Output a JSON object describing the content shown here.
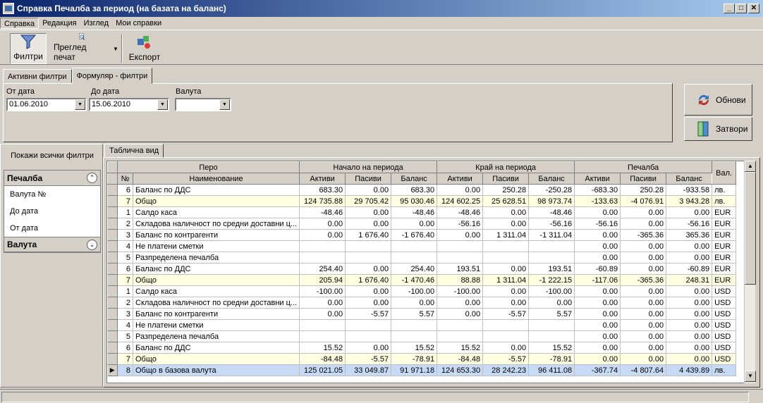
{
  "window": {
    "title": "Справка Печалба за период (на базата на баланс)"
  },
  "menu": [
    "Справка",
    "Редакция",
    "Изглед",
    "Мои справки"
  ],
  "toolbar": {
    "filters": "Филтри",
    "preview": "Преглед печат",
    "export": "Експорт"
  },
  "filter_tabs": [
    "Активни филтри",
    "Формуляр - филтри"
  ],
  "filters": {
    "from_label": "От дата",
    "from_value": "01.06.2010",
    "to_label": "До дата",
    "to_value": "15.06.2010",
    "currency_label": "Валута",
    "currency_value": ""
  },
  "buttons": {
    "refresh": "Обнови",
    "close": "Затвори"
  },
  "left": {
    "show_all": "Покажи всички филтри",
    "groups": [
      {
        "title": "Печалба",
        "items": [
          "Валута №",
          "До дата",
          "От дата"
        ]
      },
      {
        "title": "Валута",
        "items": []
      }
    ]
  },
  "grid_tab": "Таблична вид",
  "table": {
    "group_headers": [
      "Перо",
      "Начало на периода",
      "Край на периода",
      "Печалба",
      "Вал."
    ],
    "sub_headers": [
      "№",
      "Наименование",
      "Активи",
      "Пасиви",
      "Баланс",
      "Активи",
      "Пасиви",
      "Баланс",
      "Активи",
      "Пасиви",
      "Баланс"
    ],
    "rows": [
      {
        "type": "",
        "cells": [
          "6",
          "Баланс по ДДС",
          "683.30",
          "0.00",
          "683.30",
          "0.00",
          "250.28",
          "-250.28",
          "-683.30",
          "250.28",
          "-933.58",
          "лв."
        ]
      },
      {
        "type": "total",
        "cells": [
          "7",
          "Общо",
          "124 735.88",
          "29 705.42",
          "95 030.46",
          "124 602.25",
          "25 628.51",
          "98 973.74",
          "-133.63",
          "-4 076.91",
          "3 943.28",
          "лв."
        ]
      },
      {
        "type": "",
        "cells": [
          "1",
          "Салдо каса",
          "-48.46",
          "0.00",
          "-48.46",
          "-48.46",
          "0.00",
          "-48.46",
          "0.00",
          "0.00",
          "0.00",
          "EUR"
        ]
      },
      {
        "type": "",
        "cells": [
          "2",
          "Складова наличност по средни доставни ц...",
          "0.00",
          "0.00",
          "0.00",
          "-56.16",
          "0.00",
          "-56.16",
          "-56.16",
          "0.00",
          "-56.16",
          "EUR"
        ]
      },
      {
        "type": "",
        "cells": [
          "3",
          "Баланс по контрагенти",
          "0.00",
          "1 676.40",
          "-1 676.40",
          "0.00",
          "1 311.04",
          "-1 311.04",
          "0.00",
          "-365.36",
          "365.36",
          "EUR"
        ]
      },
      {
        "type": "",
        "cells": [
          "4",
          "Не платени сметки",
          "",
          "",
          "",
          "",
          "",
          "",
          "0.00",
          "0.00",
          "0.00",
          "EUR"
        ]
      },
      {
        "type": "",
        "cells": [
          "5",
          "Разпределена печалба",
          "",
          "",
          "",
          "",
          "",
          "",
          "0.00",
          "0.00",
          "0.00",
          "EUR"
        ]
      },
      {
        "type": "",
        "cells": [
          "6",
          "Баланс по ДДС",
          "254.40",
          "0.00",
          "254.40",
          "193.51",
          "0.00",
          "193.51",
          "-60.89",
          "0.00",
          "-60.89",
          "EUR"
        ]
      },
      {
        "type": "total",
        "cells": [
          "7",
          "Общо",
          "205.94",
          "1 676.40",
          "-1 470.46",
          "88.88",
          "1 311.04",
          "-1 222.15",
          "-117.06",
          "-365.36",
          "248.31",
          "EUR"
        ]
      },
      {
        "type": "",
        "cells": [
          "1",
          "Салдо каса",
          "-100.00",
          "0.00",
          "-100.00",
          "-100.00",
          "0.00",
          "-100.00",
          "0.00",
          "0.00",
          "0.00",
          "USD"
        ]
      },
      {
        "type": "",
        "cells": [
          "2",
          "Складова наличност по средни доставни ц...",
          "0.00",
          "0.00",
          "0.00",
          "0.00",
          "0.00",
          "0.00",
          "0.00",
          "0.00",
          "0.00",
          "USD"
        ]
      },
      {
        "type": "",
        "cells": [
          "3",
          "Баланс по контрагенти",
          "0.00",
          "-5.57",
          "5.57",
          "0.00",
          "-5.57",
          "5.57",
          "0.00",
          "0.00",
          "0.00",
          "USD"
        ]
      },
      {
        "type": "",
        "cells": [
          "4",
          "Не платени сметки",
          "",
          "",
          "",
          "",
          "",
          "",
          "0.00",
          "0.00",
          "0.00",
          "USD"
        ]
      },
      {
        "type": "",
        "cells": [
          "5",
          "Разпределена печалба",
          "",
          "",
          "",
          "",
          "",
          "",
          "0.00",
          "0.00",
          "0.00",
          "USD"
        ]
      },
      {
        "type": "",
        "cells": [
          "6",
          "Баланс по ДДС",
          "15.52",
          "0.00",
          "15.52",
          "15.52",
          "0.00",
          "15.52",
          "0.00",
          "0.00",
          "0.00",
          "USD"
        ]
      },
      {
        "type": "total",
        "cells": [
          "7",
          "Общо",
          "-84.48",
          "-5.57",
          "-78.91",
          "-84.48",
          "-5.57",
          "-78.91",
          "0.00",
          "0.00",
          "0.00",
          "USD"
        ]
      },
      {
        "type": "grand",
        "cells": [
          "8",
          "Общо в базова валута",
          "125 021.05",
          "33 049.87",
          "91 971.18",
          "124 653.30",
          "28 242.23",
          "96 411.08",
          "-367.74",
          "-4 807.64",
          "4 439.89",
          "лв."
        ]
      }
    ]
  }
}
